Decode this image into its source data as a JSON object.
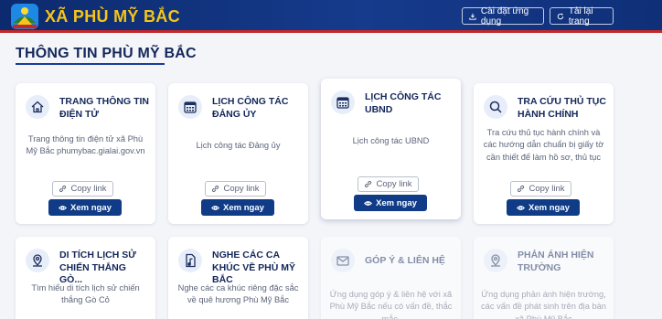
{
  "header": {
    "title": "XÃ PHÙ MỸ BẮC",
    "install_label": "Cài đặt ứng dụng",
    "reload_label": "Tải lại trang"
  },
  "section": {
    "title": "THÔNG TIN PHÙ MỸ BẮC"
  },
  "cards": [
    {
      "title": "TRANG THÔNG TIN ĐIỆN TỬ",
      "desc": "Trang thông tin điện tử xã Phù Mỹ Bắc phumybac.gialai.gov.vn",
      "copy": "Copy link",
      "view": "Xem ngay",
      "icon": "home-icon"
    },
    {
      "title": "LỊCH CÔNG TÁC ĐẢNG ỦY",
      "desc": "Lịch công tác Đảng ủy",
      "copy": "Copy link",
      "view": "Xem ngay",
      "icon": "calendar-icon"
    },
    {
      "title": "LỊCH CÔNG TÁC UBND",
      "desc": "Lịch công tác UBND",
      "copy": "Copy link",
      "view": "Xem ngay",
      "icon": "calendar-icon"
    },
    {
      "title": "TRA CỨU THỦ TỤC HÀNH CHÍNH",
      "desc": "Tra cứu thủ tục hành chính và các hướng dẫn chuẩn bị giấy tờ cần thiết để làm hồ sơ, thủ tục",
      "copy": "Copy link",
      "view": "Xem ngay",
      "icon": "search-icon"
    },
    {
      "title": "DI TÍCH LỊCH SỬ CHIẾN THẮNG GÒ...",
      "desc": "Tìm hiểu di tích lịch sử chiến thắng Gò Cỏ",
      "icon": "map-pin-icon"
    },
    {
      "title": "NGHE CÁC CA KHÚC VỀ PHÙ MỸ BẮC",
      "desc": "Nghe các ca khúc riêng đặc sắc về quê hương Phù Mỹ Bắc",
      "icon": "music-file-icon"
    },
    {
      "title": "GÓP Ý & LIÊN HỆ",
      "desc": "Ứng dụng góp ý & liên hệ với xã Phù Mỹ Bắc nếu có vấn đề, thắc mắc.",
      "icon": "mail-icon"
    },
    {
      "title": "PHẢN ÁNH HIỆN TRƯỜNG",
      "desc": "Ứng dụng phản ánh hiện trường, các vấn đề phát sinh trên địa bàn xã Phù Mỹ Bắc",
      "icon": "map-pin-icon"
    }
  ]
}
